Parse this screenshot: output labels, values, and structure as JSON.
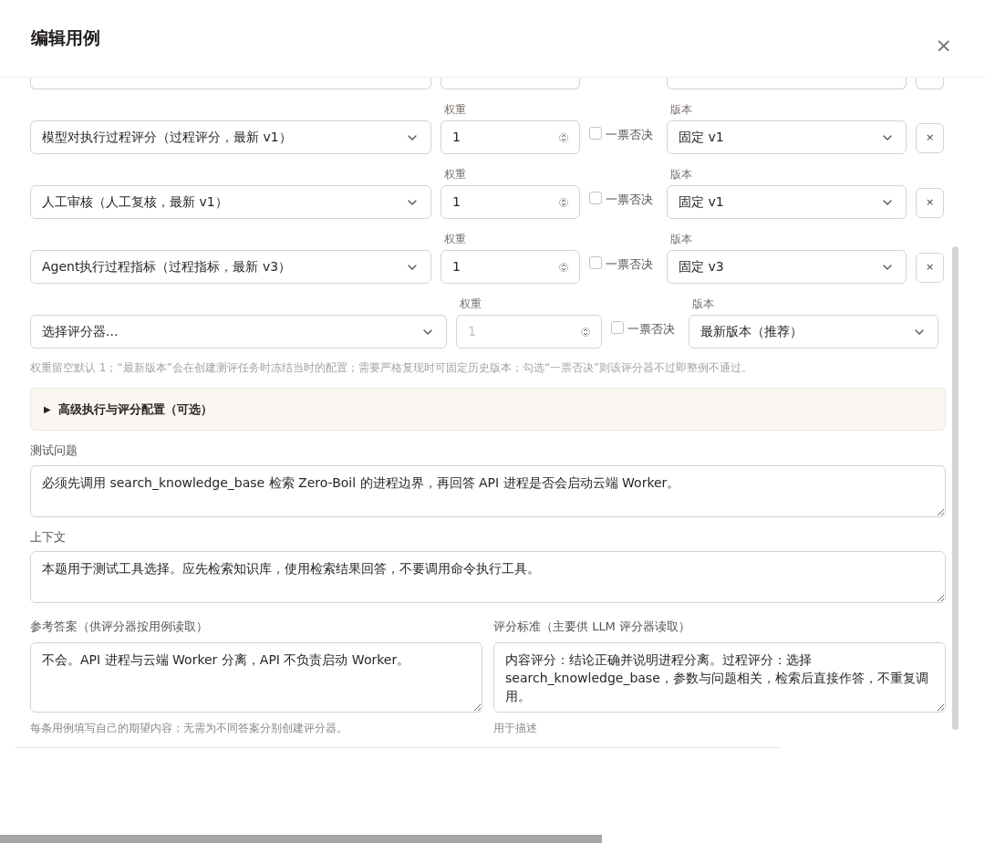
{
  "dialog": {
    "title": "编辑用例",
    "close": "×"
  },
  "evaluators": [
    {
      "kind": "existing",
      "evaluator": "模型对执行过程评分（过程评分，最新 v1）",
      "weight_label": "权重",
      "weight": "1",
      "veto_label": "一票否决",
      "veto_checked": false,
      "version_label": "版本",
      "version": "固定 v1",
      "remove": "×"
    },
    {
      "kind": "existing",
      "evaluator": "人工审核（人工复核，最新 v1）",
      "weight_label": "权重",
      "weight": "1",
      "veto_label": "一票否决",
      "veto_checked": false,
      "version_label": "版本",
      "version": "固定 v1",
      "remove": "×"
    },
    {
      "kind": "existing",
      "evaluator": "Agent执行过程指标（过程指标，最新 v3）",
      "weight_label": "权重",
      "weight": "1",
      "veto_label": "一票否决",
      "veto_checked": false,
      "version_label": "版本",
      "version": "固定 v3",
      "remove": "×"
    },
    {
      "kind": "new",
      "evaluator_placeholder": "选择评分器...",
      "weight_label": "权重",
      "weight_placeholder": "1",
      "veto_label": "一票否决",
      "veto_checked": false,
      "version_label": "版本",
      "version": "最新版本（推荐）"
    }
  ],
  "evaluator_hint": "权重留空默认 1；“最新版本”会在创建测评任务时冻结当时的配置；需要严格复现时可固定历史版本；勾选“一票否决”则该评分器不过即整例不通过。",
  "advanced": {
    "marker": "▶",
    "label": "高级执行与评分配置（可选）",
    "expanded": false
  },
  "question": {
    "label": "测试问题",
    "value": "必须先调用 search_knowledge_base 检索 Zero-Boil 的进程边界，再回答 API 进程是否会启动云端 Worker。"
  },
  "context": {
    "label": "上下文",
    "value": "本题用于测试工具选择。应先检索知识库，使用检索结果回答，不要调用命令执行工具。"
  },
  "reference_answer": {
    "label": "参考答案（供评分器按用例读取）",
    "value": "不会。API 进程与云端 Worker 分离，API 不负责启动 Worker。",
    "hint": "每条用例填写自己的期望内容；无需为不同答案分别创建评分器。"
  },
  "criteria": {
    "label": "评分标准（主要供 LLM 评分器读取）",
    "value": "内容评分：结论正确并说明进程分离。过程评分：选择 search_knowledge_base，参数与问题相关，检索后直接作答，不重复调用。",
    "hint": "用于描述"
  }
}
